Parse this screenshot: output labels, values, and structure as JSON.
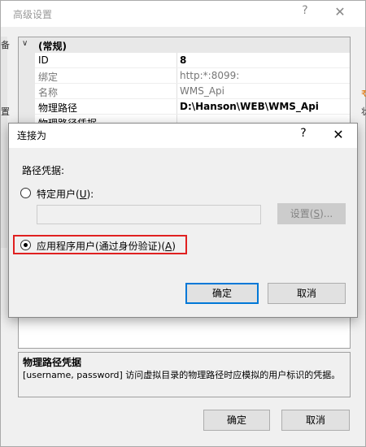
{
  "background_dialog": {
    "title": "高级设置",
    "help_glyph": "?",
    "close_glyph": "✕",
    "strip_left": [
      "备",
      "置"
    ],
    "strip_right": [
      "₹",
      "状"
    ],
    "category": "(常规)",
    "category_caret": "∨",
    "properties": [
      {
        "name": "ID",
        "value": "8"
      },
      {
        "name": "绑定",
        "value": "http:*:8099:"
      },
      {
        "name": "名称",
        "value": "WMS_Api"
      },
      {
        "name": "物理路径",
        "value": "D:\\Hanson\\WEB\\WMS_Api"
      },
      {
        "name": "物理路径凭据",
        "value": ""
      }
    ],
    "description": {
      "title": "物理路径凭据",
      "text": "[username, password] 访问虚拟目录的物理路径时应模拟的用户标识的凭据。"
    },
    "ok_label": "确定",
    "cancel_label": "取消"
  },
  "connect_dialog": {
    "title": "连接为",
    "help_glyph": "?",
    "close_glyph": "✕",
    "section_label": "路径凭据:",
    "specific_user": {
      "prefix": "特定用户(",
      "key": "U",
      "suffix": "):"
    },
    "user_value": "",
    "settings": {
      "prefix": "设置(",
      "key": "S",
      "suffix": ")..."
    },
    "app_user": {
      "prefix": "应用程序用户(通过身份验证)(",
      "key": "A",
      "suffix": ")"
    },
    "selected": "app_user",
    "ok_label": "确定",
    "cancel_label": "取消"
  },
  "colors": {
    "accent": "#0078d7",
    "highlight": "#e02020"
  }
}
